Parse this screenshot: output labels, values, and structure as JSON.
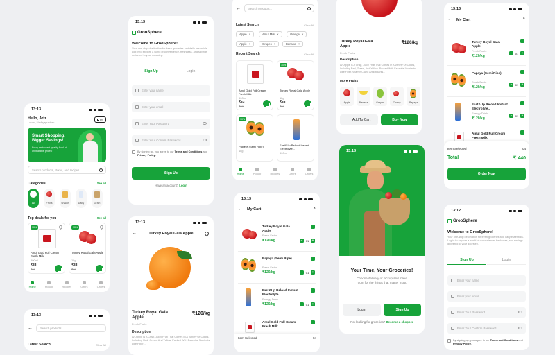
{
  "status": {
    "time": "13:13",
    "time2": "13:12"
  },
  "home": {
    "greeting": "Hello, Ariz",
    "location": "Lokoni, Madhyapradesh",
    "cart_count": "04",
    "banner_title": "Smart Shopping, Bigger Savings!",
    "banner_sub": "Enjoy restaurant-quality food at unbeatable prices!",
    "search_placeholder": "Search products, stores, and recipes",
    "categories_title": "Categories",
    "see_all": "See all",
    "categories": [
      "All",
      "Fruits",
      "Snacks",
      "Dairy",
      "Grain"
    ],
    "top_deals_title": "Top deals for you",
    "products": [
      {
        "badge": "10%",
        "name": "Amul Gold Full Cream Fresh Milk",
        "qty": "500ml",
        "price": "₹33",
        "old": "₹40"
      },
      {
        "badge": "10%",
        "name": "Turkey Royal Gala Apple",
        "qty": "1kg",
        "price": "₹33",
        "old": "₹40"
      }
    ],
    "nav": [
      "Home",
      "Pickup",
      "Recipes",
      "Offers",
      "Orders"
    ]
  },
  "signup": {
    "brand": "GrooSphere",
    "welcome": "Welcome to GrooSphere!",
    "intro": "Your one-stop destination for fresh groceries and daily essentials. Log in to explore a world of convenience, freshness, and savings delivered to your doorstep.",
    "tab_signup": "Sign Up",
    "tab_login": "Login",
    "name_placeholder": "Enter your name",
    "email_placeholder": "Enter your email",
    "password_placeholder": "Enter Your Password",
    "confirm_placeholder": "Enter Your Confirm Password",
    "terms_prefix": "By signing up, you agree to our",
    "terms_link": "Terms and Conditions",
    "and": "and",
    "privacy_link": "Privacy Policy.",
    "button": "Sign Up",
    "have_account": "Have an account?",
    "login_link": "Login"
  },
  "search": {
    "placeholder": "Search products...",
    "latest_title": "Latest Search",
    "clear_all": "Clear All",
    "latest_chips": [
      "Apple",
      "Amul Milk",
      "Orange",
      "Apple",
      "Grapes",
      "Banana"
    ],
    "recent_title": "Recent Search",
    "products": [
      {
        "badge": "",
        "name": "Amul Gold Full Cream Fresh Milk",
        "qty": "500ml",
        "price": "₹33",
        "old": "₹40"
      },
      {
        "badge": "10%",
        "name": "Turkey Royal Gala Apple",
        "qty": "1kg",
        "price": "₹33",
        "old": "₹40"
      },
      {
        "badge": "10%",
        "name": "Papaya (Semi Ripe)",
        "qty": "1kg",
        "price": "₹33",
        "old": "₹40"
      },
      {
        "badge": "",
        "name": "Fast&Up Reload Instant Electrolyte...",
        "qty": "500ml",
        "price": "₹33",
        "old": "₹40"
      }
    ]
  },
  "detail": {
    "title": "Turkey Royal Gala Apple",
    "price": "₹120/kg",
    "category": "Fresh Fruits",
    "description_title": "Description",
    "description": "An Apple Is A Crisp, Juicy Fruit That Comes In A Variety Of Colors, Including Red, Green, And Yellow. Packed With Essential Nutrients Like Fiber, Vitamin C And Antioxidants...",
    "more_title": "More Fruits",
    "more_fruits": [
      "Apple",
      "Banana",
      "Grapes",
      "Cherry",
      "Papaya"
    ],
    "add_to_cart": "Add To Cart",
    "buy_now": "Buy Now"
  },
  "cart": {
    "title": "My Cart",
    "items": [
      {
        "name": "Turkey Royal Gala Apple",
        "cat": "Fresh Fruits",
        "price": "₹120/kg",
        "qty": "01"
      },
      {
        "name": "Papaya (Semi Ripe)",
        "cat": "Fresh Fruits",
        "price": "₹120/kg",
        "qty": "01"
      },
      {
        "name": "Fast&Up Reload Instant Electrolyte...",
        "cat": "Energy Drink",
        "price": "₹120/kg",
        "qty": "01"
      },
      {
        "name": "Amul Gold Full Cream Fresh Milk",
        "cat": "",
        "price": "",
        "qty": ""
      }
    ],
    "item_selected": "Item Selected",
    "item_count": "04",
    "total_label": "Total",
    "total_value": "₹ 440",
    "order_now": "Order Now"
  },
  "onboard": {
    "title": "Your Time, Your Groceries!",
    "subtitle": "Choose delivery or pickup and make room for the things that matter most.",
    "login": "Login",
    "signup": "Sign Up",
    "not_looking": "Not looking for groceries?",
    "become_shopper": "Become a shopper"
  },
  "detail2": {
    "title": "Turkey Royal Gala Apple",
    "price": "₹120/kg",
    "category": "Fresh Fruits",
    "description_title": "Description",
    "description": "An Apple Is A Crisp, Juicy Fruit That Comes In A Variety Of Colors, Including Red, Green, And Yellow. Packed With Essential Nutrients Like Fiber..."
  },
  "colors": {
    "accent": "#17a33a",
    "background": "#eeeff2"
  }
}
